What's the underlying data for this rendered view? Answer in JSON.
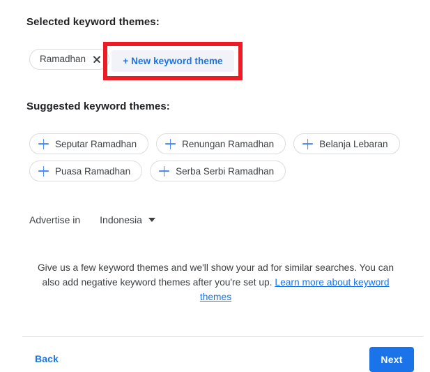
{
  "colors": {
    "accent_blue": "#1a73e8",
    "plus_blue": "#4285f4",
    "highlight_red": "#ec1c24",
    "text_primary": "#202124",
    "text_secondary": "#3c4043",
    "chip_border": "#dadce0",
    "new_theme_bg": "#f1f3f8"
  },
  "selected_section": {
    "heading": "Selected keyword themes:",
    "chips": [
      {
        "label": "Ramadhan",
        "remove_icon": "close-icon"
      }
    ],
    "new_theme_button": {
      "label": "+ New keyword theme",
      "highlighted": true
    }
  },
  "suggested_section": {
    "heading": "Suggested keyword themes:",
    "rows": [
      [
        {
          "label": "Seputar Ramadhan",
          "icon": "plus-icon"
        },
        {
          "label": "Renungan Ramadhan",
          "icon": "plus-icon"
        },
        {
          "label": "Belanja Lebaran",
          "icon": "plus-icon"
        }
      ],
      [
        {
          "label": "Puasa Ramadhan",
          "icon": "plus-icon"
        },
        {
          "label": "Serba Serbi Ramadhan",
          "icon": "plus-icon"
        }
      ]
    ]
  },
  "advertise": {
    "label": "Advertise in",
    "country": "Indonesia",
    "caret_icon": "chevron-down-icon"
  },
  "help": {
    "text_before_link": "Give us a few keyword themes and we'll show your ad for similar searches. You can also add negative keyword themes after you're set up. ",
    "link_text": "Learn more about keyword themes"
  },
  "footer": {
    "back_label": "Back",
    "next_label": "Next"
  }
}
